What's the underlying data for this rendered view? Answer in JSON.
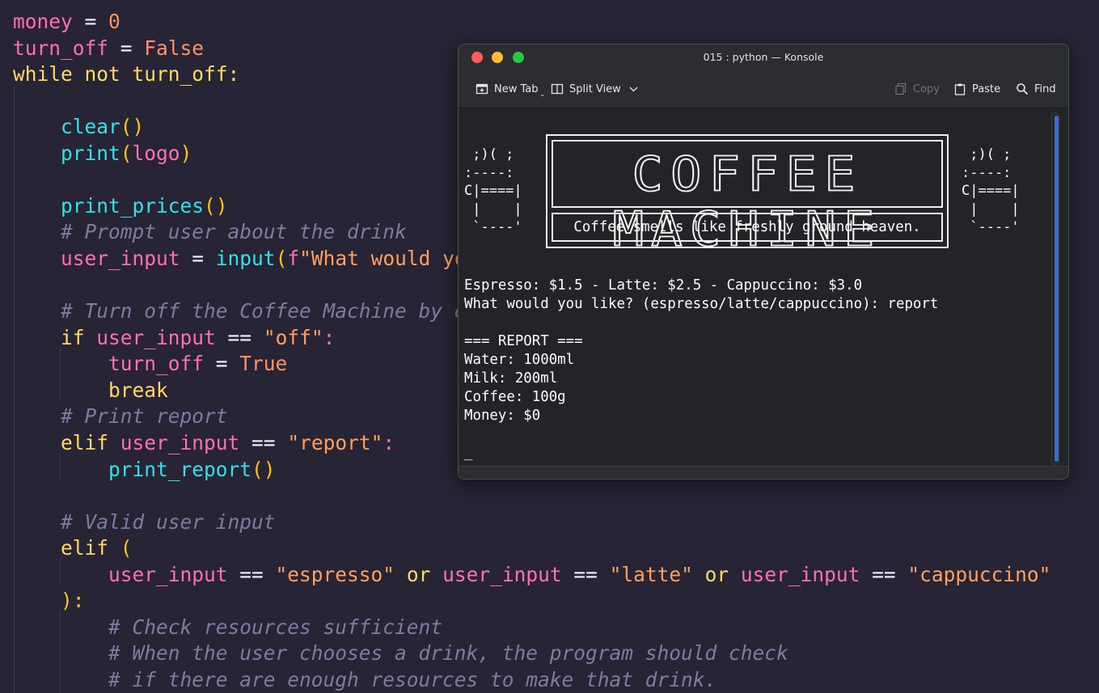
{
  "editor": {
    "lines": [
      [
        [
          "money",
          "var"
        ],
        [
          " = ",
          "op"
        ],
        [
          "0",
          "num"
        ]
      ],
      [
        [
          "turn_off",
          "var"
        ],
        [
          " = ",
          "op"
        ],
        [
          "False",
          "num"
        ]
      ],
      [
        [
          "while not turn_off:",
          "kw"
        ]
      ],
      [],
      [
        [
          "    ",
          "op"
        ],
        [
          "clear",
          "fn"
        ],
        [
          "()",
          "paren"
        ]
      ],
      [
        [
          "    ",
          "op"
        ],
        [
          "print",
          "fn"
        ],
        [
          "(",
          "paren"
        ],
        [
          "logo",
          "var"
        ],
        [
          ")",
          "paren"
        ]
      ],
      [],
      [
        [
          "    ",
          "op"
        ],
        [
          "print_prices",
          "fn"
        ],
        [
          "()",
          "paren"
        ]
      ],
      [
        [
          "    # Prompt user about the drink",
          "com"
        ]
      ],
      [
        [
          "    ",
          "op"
        ],
        [
          "user_input",
          "var"
        ],
        [
          " = ",
          "op"
        ],
        [
          "input",
          "fn"
        ],
        [
          "(",
          "paren"
        ],
        [
          "f",
          "var"
        ],
        [
          "\"What would yo",
          "str"
        ]
      ],
      [],
      [
        [
          "    # Turn off the Coffee Machine by e",
          "com"
        ]
      ],
      [
        [
          "    ",
          "op"
        ],
        [
          "if ",
          "kw"
        ],
        [
          "user_input",
          "var"
        ],
        [
          " == ",
          "op"
        ],
        [
          "\"off\"",
          "str"
        ],
        [
          ":",
          "var"
        ]
      ],
      [
        [
          "        ",
          "op"
        ],
        [
          "turn_off",
          "var"
        ],
        [
          " = ",
          "op"
        ],
        [
          "True",
          "num"
        ]
      ],
      [
        [
          "        ",
          "op"
        ],
        [
          "break",
          "kw"
        ]
      ],
      [
        [
          "    # Print report",
          "com"
        ]
      ],
      [
        [
          "    ",
          "op"
        ],
        [
          "elif ",
          "kw"
        ],
        [
          "user_input",
          "var"
        ],
        [
          " == ",
          "op"
        ],
        [
          "\"report\"",
          "str"
        ],
        [
          ":",
          "var"
        ]
      ],
      [
        [
          "        ",
          "op"
        ],
        [
          "print_report",
          "fn"
        ],
        [
          "()",
          "paren"
        ]
      ],
      [],
      [
        [
          "    # Valid user input",
          "com"
        ]
      ],
      [
        [
          "    ",
          "op"
        ],
        [
          "elif ",
          "kw"
        ],
        [
          "(",
          "paren"
        ]
      ],
      [
        [
          "        ",
          "op"
        ],
        [
          "user_input",
          "var"
        ],
        [
          " == ",
          "op"
        ],
        [
          "\"espresso\"",
          "str"
        ],
        [
          " or ",
          "kw"
        ],
        [
          "user_input",
          "var"
        ],
        [
          " == ",
          "op"
        ],
        [
          "\"latte\"",
          "str"
        ],
        [
          " or ",
          "kw"
        ],
        [
          "user_input",
          "var"
        ],
        [
          " == ",
          "op"
        ],
        [
          "\"cappuccino\"",
          "str"
        ]
      ],
      [
        [
          "    ",
          "op"
        ],
        [
          "):",
          "paren"
        ]
      ],
      [
        [
          "        # Check resources sufficient",
          "com"
        ]
      ],
      [
        [
          "        # When the user chooses a drink, the program should check",
          "com"
        ]
      ],
      [
        [
          "        # if there are enough resources to make that drink.",
          "com"
        ]
      ]
    ]
  },
  "konsole": {
    "title": "015 : python — Konsole",
    "toolbar": {
      "new_tab": "New Tab",
      "split_view": "Split View",
      "copy": "Copy",
      "paste": "Paste",
      "find": "Find"
    },
    "mug_left": " ;)( ;\n:----:\nC|====|\n |    |\n `----'",
    "mug_right": " ;)( ;\n:----:\nC|====|\n |    |\n `----'",
    "banner_title": "COFFEE MACHINE",
    "tagline": "Coffee smells like freshly ground heaven.",
    "output_lines": [
      "Espresso: $1.5 - Latte: $2.5 - Cappuccino: $3.0",
      "What would you like? (espresso/latte/cappuccino): report",
      "",
      "=== REPORT ===",
      "Water: 1000ml",
      "Milk: 200ml",
      "Coffee: 100g",
      "Money: $0",
      "",
      "_"
    ]
  },
  "colors": {
    "editor_bg": "#272535",
    "terminal_bg": "#232427",
    "scrollbar_accent": "#3d6fc8"
  }
}
